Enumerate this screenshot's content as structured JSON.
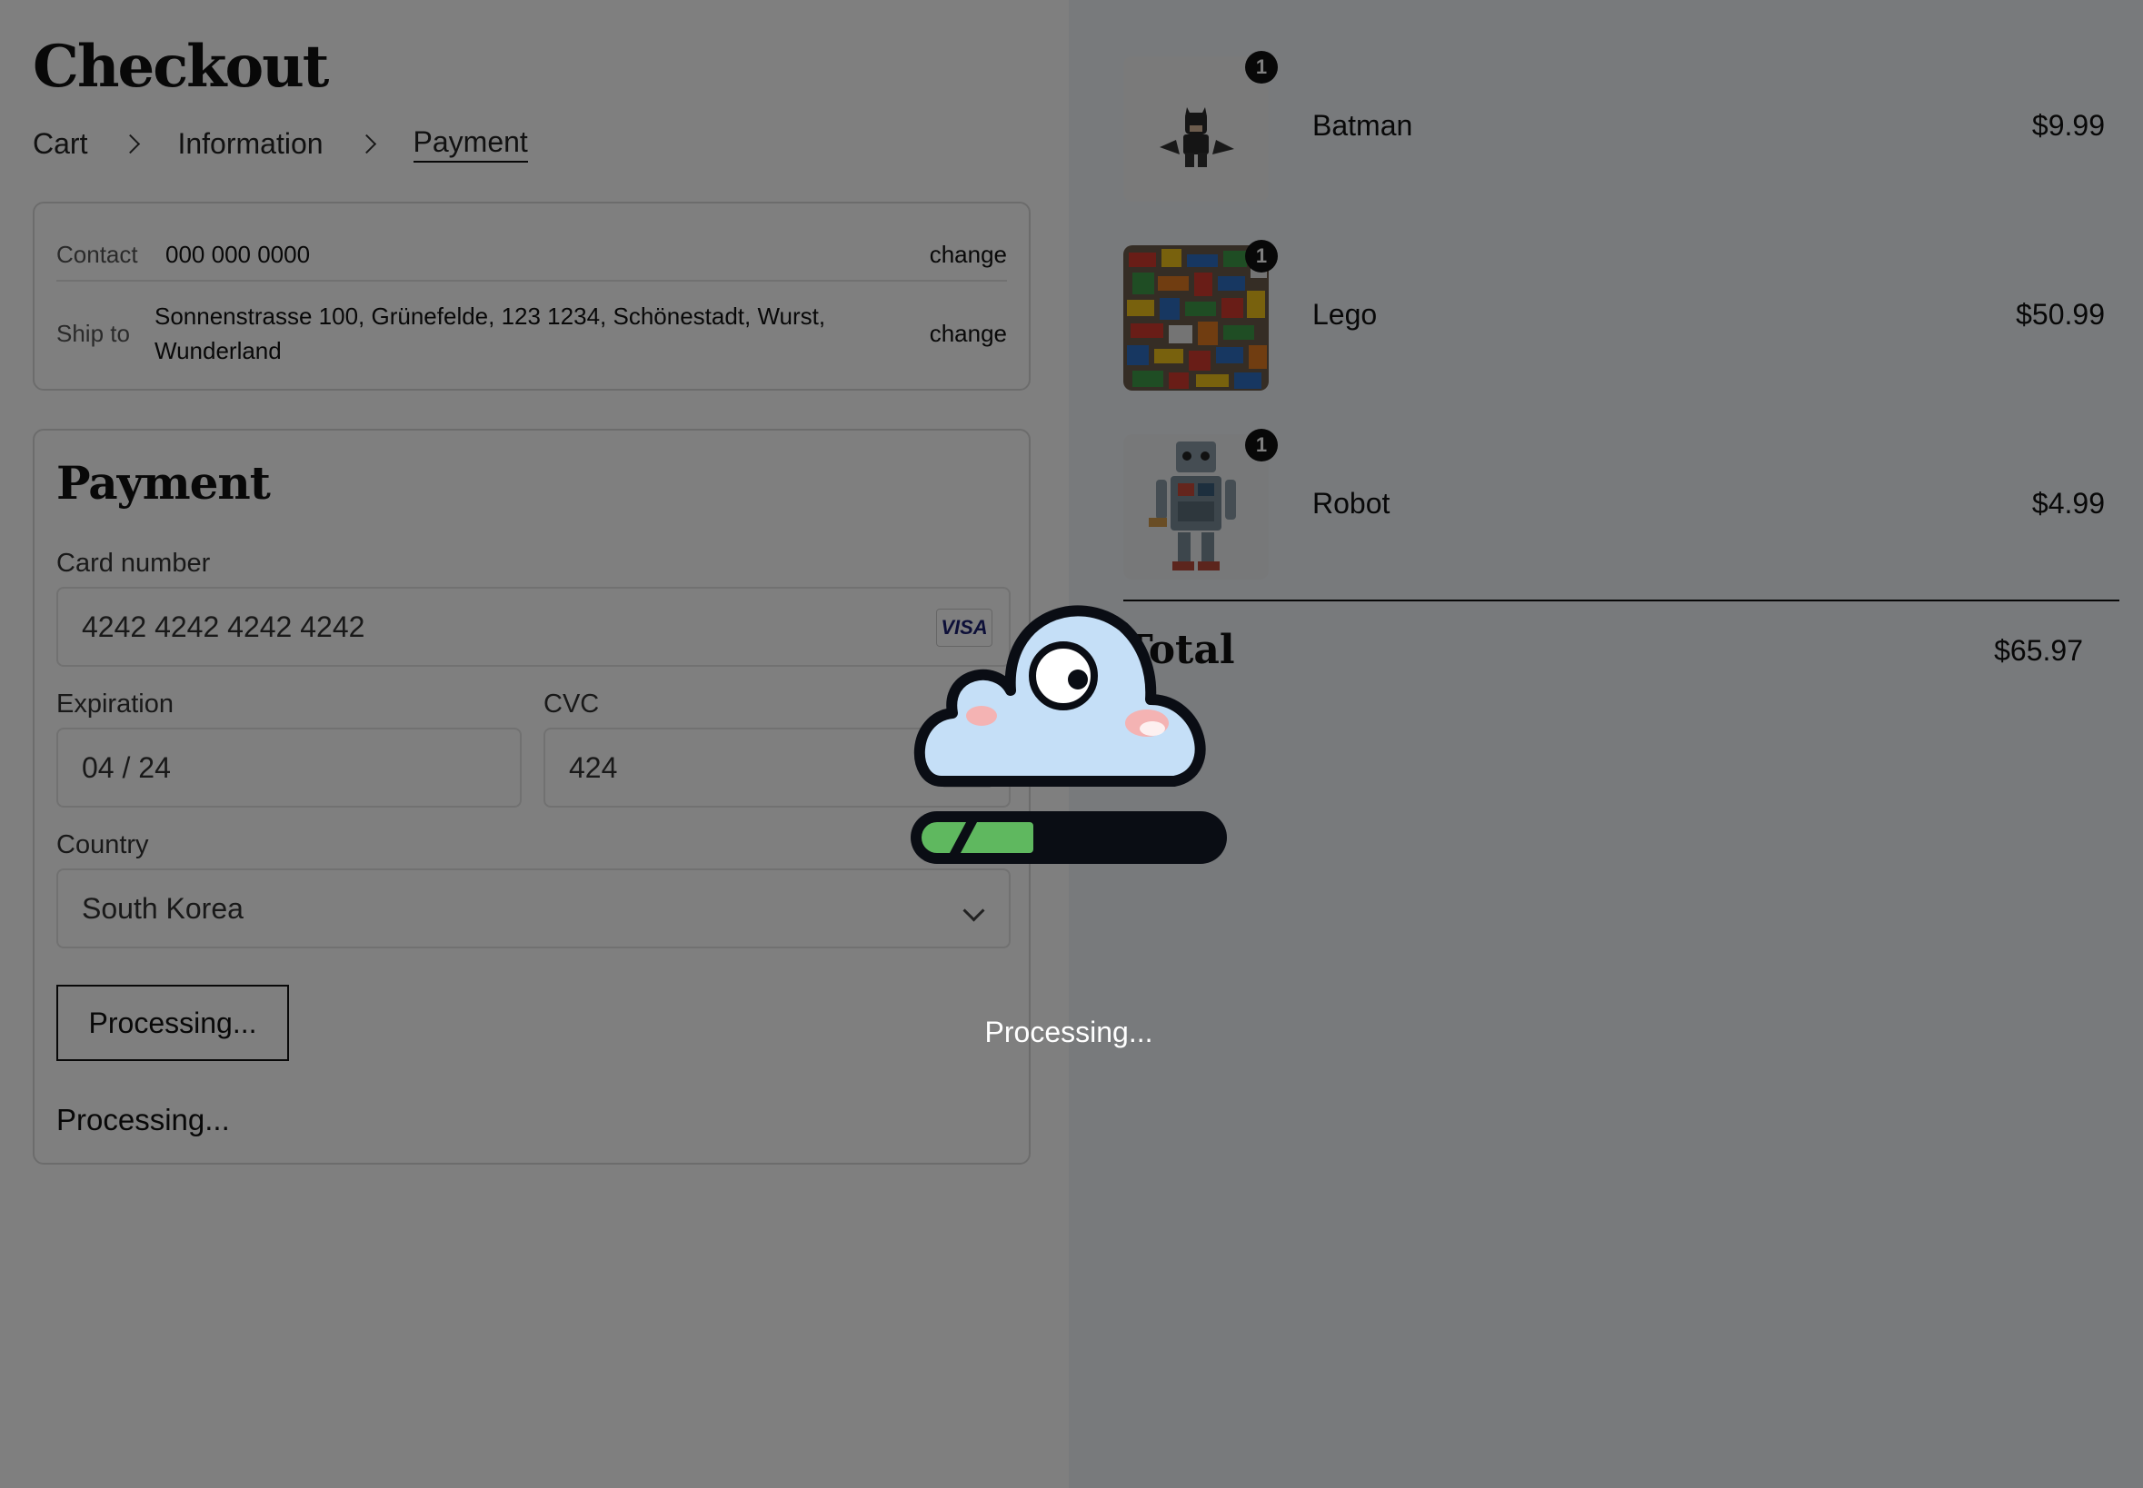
{
  "checkout": {
    "title": "Checkout",
    "breadcrumb": [
      "Cart",
      "Information",
      "Payment"
    ]
  },
  "summary": {
    "contact_label": "Contact",
    "contact_value": "000 000 0000",
    "ship_label": "Ship to",
    "ship_value": "Sonnenstrasse 100, Grünefelde, 123 1234, Schönestadt, Wurst, Wunderland",
    "change_label": "change"
  },
  "payment": {
    "title": "Payment",
    "card_label": "Card number",
    "card_value": "4242 4242 4242 4242",
    "card_brand": "VISA",
    "expiration_label": "Expiration",
    "expiration_value": "04 / 24",
    "cvc_label": "CVC",
    "cvc_value": "424",
    "country_label": "Country",
    "country_value": "South Korea",
    "submit_label": "Processing...",
    "status_message": "Processing..."
  },
  "cart": {
    "items": [
      {
        "name": "Batman",
        "price": "$9.99",
        "qty": "1"
      },
      {
        "name": "Lego",
        "price": "$50.99",
        "qty": "1"
      },
      {
        "name": "Robot",
        "price": "$4.99",
        "qty": "1"
      }
    ],
    "total_label": "Total",
    "total_value": "$65.97"
  },
  "overlay": {
    "message": "Processing...",
    "progress": 0.38
  },
  "colors": {
    "overlay_dim": "#000000",
    "progress_fill": "#5fb85f",
    "cloud_fill": "#c5dff7"
  }
}
